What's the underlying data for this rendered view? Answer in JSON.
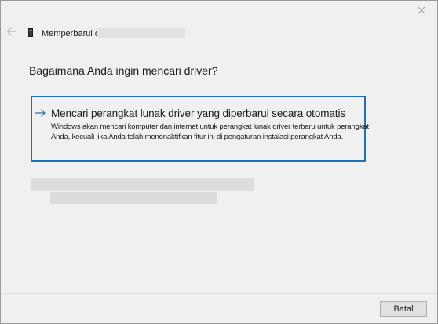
{
  "window": {
    "title": "Memperbarui driver",
    "icons": {
      "close": "close-icon",
      "back": "back-arrow-icon",
      "device": "device-icon"
    }
  },
  "main": {
    "question": "Bagaimana Anda ingin mencari driver?",
    "option": {
      "title": "Mencari perangkat lunak driver yang diperbarui secara otomatis",
      "description": "Windows akan mencari komputer dan internet untuk perangkat lunak driver terbaru untuk perangkat Anda, kecuali jika Anda telah menonaktifkan fitur ini di pengaturan instalasi perangkat Anda.",
      "icon": "right-arrow-icon",
      "border_color": "#1f6fb5"
    }
  },
  "footer": {
    "cancel_label": "Batal"
  }
}
